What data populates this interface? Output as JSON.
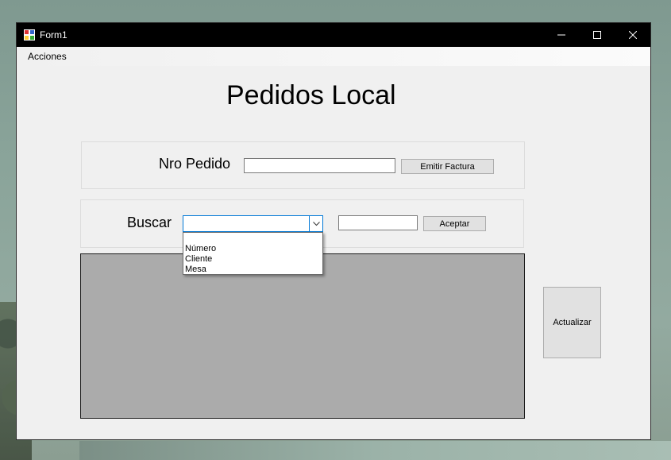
{
  "window": {
    "title": "Form1",
    "controls": {
      "minimize": "minimize-icon",
      "maximize": "maximize-icon",
      "close": "close-icon"
    }
  },
  "menu": {
    "items": [
      "Acciones"
    ]
  },
  "header": {
    "title": "Pedidos Local"
  },
  "order": {
    "label": "Nro Pedido",
    "value": "",
    "button_label": "Emitir Factura"
  },
  "search": {
    "label": "Buscar",
    "combo_value": "",
    "options": [
      "",
      "Número",
      "Cliente",
      "Mesa"
    ],
    "value": "",
    "button_label": "Aceptar"
  },
  "actions": {
    "refresh_label": "Actualizar"
  },
  "colors": {
    "titlebar": "#000000",
    "focus": "#0078d7",
    "grid": "#ababab",
    "window_bg": "#f0f0f0"
  }
}
